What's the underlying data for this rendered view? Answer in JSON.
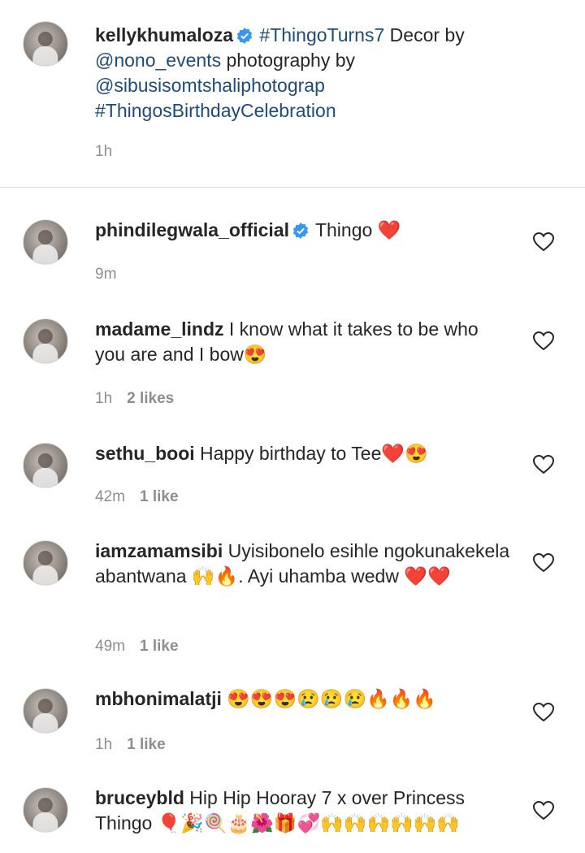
{
  "caption": {
    "username": "kellykhumaloza",
    "text_parts": [
      {
        "t": "#ThingoTurns7",
        "link": true
      },
      {
        "t": " Decor by ",
        "link": false
      },
      {
        "t": "@nono_events",
        "link": true
      },
      {
        "t": " photography by ",
        "link": false
      },
      {
        "t": "@sibusisomtshaliphotograp",
        "link": true
      },
      {
        "t": " ",
        "link": false
      },
      {
        "t": "#ThingosBirthdayCelebration",
        "link": true
      }
    ],
    "time": "1h"
  },
  "comments": [
    {
      "username": "phindilegwala_official",
      "verified": true,
      "text": " Thingo ❤️",
      "time": "9m",
      "likes": ""
    },
    {
      "username": "madame_lindz",
      "verified": false,
      "text": " I know what it takes to be who you are and I bow😍",
      "time": "1h",
      "likes": "2 likes"
    },
    {
      "username": "sethu_booi",
      "verified": false,
      "text": " Happy birthday to Tee❤️😍",
      "time": "42m",
      "likes": "1 like"
    },
    {
      "username": "iamzamamsibi",
      "verified": false,
      "text": " Uyisibonelo esihle ngokunakekela abantwana 🙌🔥. Ayi uhamba wedw ❤️❤️",
      "time": "49m",
      "likes": "1 like"
    },
    {
      "username": "mbhonimalatji",
      "verified": false,
      "text": " 😍😍😍😢😢😢🔥🔥🔥",
      "time": "1h",
      "likes": "1 like"
    },
    {
      "username": "bruceybld",
      "verified": false,
      "text": " Hip Hip Hooray 7 x over Princess Thingo 🎈🎉🍭🎂🌺🎁💞🙌🙌🙌🙌🙌🙌",
      "time": "",
      "likes": ""
    }
  ],
  "icons": {
    "verified": "verified-badge-icon",
    "like": "heart-outline-icon"
  },
  "colors": {
    "link": "#1f4b77",
    "muted": "#8e8e8e",
    "verified": "#3897f0"
  }
}
